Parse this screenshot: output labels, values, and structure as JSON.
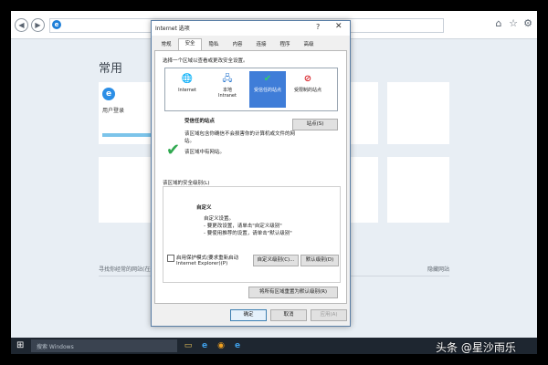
{
  "home": {
    "title": "常用",
    "tile_label": "用户登录",
    "footer_left": "寻找你经常的网站(在这里)",
    "footer_right": "隐藏网站"
  },
  "dialog": {
    "title": "Internet 选项",
    "help": "?",
    "close": "✕",
    "tabs": [
      "常规",
      "安全",
      "隐私",
      "内容",
      "连接",
      "程序",
      "高级"
    ],
    "active_tab": "安全",
    "zone_prompt": "选择一个区域以查看或更改安全设置。",
    "zones": [
      {
        "label": "Internet",
        "icon": "globe-icon"
      },
      {
        "label": "本地\nIntranet",
        "icon": "intranet-icon"
      },
      {
        "label": "受信任的站点",
        "icon": "check-icon",
        "selected": true
      },
      {
        "label": "受限制的站点",
        "icon": "blocked-icon"
      }
    ],
    "zone_heading": "受信任的站点",
    "sites_button": "站点(S)",
    "zone_desc_1": "该区域包含你确信不会损害你的计算机或文件的网",
    "zone_desc_2": "站。",
    "zone_desc_3": "该区域中有网站。",
    "level_legend": "该区域的安全级别(L)",
    "level_title": "自定义",
    "level_line_1": "自定义设置。",
    "level_line_2": "- 要更改设置，请单击\"自定义级别\"",
    "level_line_3": "- 要使用推荐的设置，请单击\"默认级别\"",
    "protected_mode_1": "启用保护模式(要求重新启动",
    "protected_mode_2": "Internet Explorer)(P)",
    "custom_level_button": "自定义级别(C)...",
    "default_level_button": "默认级别(D)",
    "reset_all_button": "将所有区域重置为默认级别(R)",
    "ok_button": "确定",
    "cancel_button": "取消",
    "apply_button": "应用(A)"
  },
  "taskbar": {
    "search_placeholder": "搜索 Windows"
  },
  "watermark": "头条 @星沙雨乐",
  "colors": {
    "accent": "#3f7dd8",
    "trusted_check": "#2fa84f",
    "blocked": "#d9262c",
    "taskbar": "#1e2630"
  }
}
